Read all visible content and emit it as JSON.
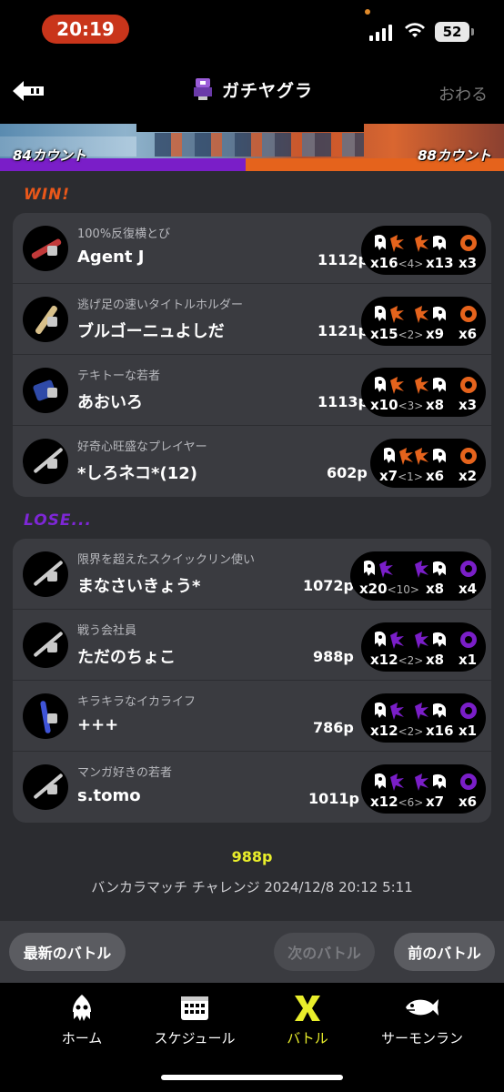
{
  "status": {
    "time": "20:19",
    "battery": "52"
  },
  "header": {
    "title": "ガチヤグラ",
    "close_label": "おわる"
  },
  "teams": {
    "left_count": "84カウント",
    "right_count": "88カウント",
    "left_color": "#7a1ec8",
    "right_color": "#e5631c"
  },
  "win": {
    "label": "WIN!",
    "players": [
      {
        "title": "100%反復横とび",
        "name": "Agent J",
        "points": "1112p",
        "kills": "x16",
        "assists": "<4>",
        "specials_used": "x13",
        "special": "x3"
      },
      {
        "title": "逃げ足の速いタイトルホルダー",
        "name": "ブルゴーニュよしだ",
        "points": "1121p",
        "kills": "x15",
        "assists": "<2>",
        "specials_used": "x9",
        "special": "x6"
      },
      {
        "title": "テキトーな若者",
        "name": "あおいろ",
        "points": "1113p",
        "kills": "x10",
        "assists": "<3>",
        "specials_used": "x8",
        "special": "x3"
      },
      {
        "title": "好奇心旺盛なプレイヤー",
        "name": "*しろネコ*(12)",
        "points": "602p",
        "kills": "x7",
        "assists": "<1>",
        "specials_used": "x6",
        "special": "x2"
      }
    ]
  },
  "lose": {
    "label": "LOSE...",
    "players": [
      {
        "title": "限界を超えたスクイックリン使い",
        "name": "まなさいきょう*",
        "points": "1072p",
        "kills": "x20",
        "assists": "<10>",
        "specials_used": "x8",
        "special": "x4"
      },
      {
        "title": "戦う会社員",
        "name": "ただのちょこ",
        "points": "988p",
        "kills": "x12",
        "assists": "<2>",
        "specials_used": "x8",
        "special": "x1"
      },
      {
        "title": "キラキラなイカライフ",
        "name": "+++",
        "points": "786p",
        "kills": "x12",
        "assists": "<2>",
        "specials_used": "x16",
        "special": "x1"
      },
      {
        "title": "マンガ好きの若者",
        "name": "s.tomo",
        "points": "1011p",
        "kills": "x12",
        "assists": "<6>",
        "specials_used": "x7",
        "special": "x6"
      }
    ]
  },
  "result": {
    "points": "988p",
    "info": "バンカラマッチ チャレンジ 2024/12/8 20:12 5:11"
  },
  "nav": {
    "latest": "最新のバトル",
    "next": "次のバトル",
    "prev": "前のバトル"
  },
  "tabs": [
    {
      "label": "ホーム",
      "icon": "squid-icon"
    },
    {
      "label": "スケジュール",
      "icon": "calendar-icon"
    },
    {
      "label": "バトル",
      "icon": "battle-icon"
    },
    {
      "label": "サーモンラン",
      "icon": "salmon-icon"
    }
  ]
}
